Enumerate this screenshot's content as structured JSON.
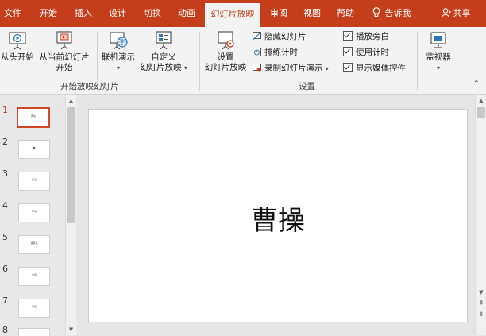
{
  "tabs": [
    {
      "label": "文件"
    },
    {
      "label": "开始"
    },
    {
      "label": "插入"
    },
    {
      "label": "设计"
    },
    {
      "label": "切换"
    },
    {
      "label": "动画"
    },
    {
      "label": "幻灯片放映"
    },
    {
      "label": "审阅"
    },
    {
      "label": "视图"
    },
    {
      "label": "帮助"
    }
  ],
  "tell_me": "告诉我",
  "share": "共享",
  "ribbon": {
    "from_beginning": "从头开始",
    "from_current_1": "从当前幻灯片",
    "from_current_2": "开始",
    "online_present": "联机演示",
    "custom_1": "自定义",
    "custom_2": "幻灯片放映",
    "group_start": "开始放映幻灯片",
    "setup_1": "设置",
    "setup_2": "幻灯片放映",
    "hide_slide": "隐藏幻灯片",
    "rehearse": "排练计时",
    "record": "录制幻灯片演示",
    "play_narration": "播放旁白",
    "use_timings": "使用计时",
    "show_media": "显示媒体控件",
    "group_setup": "设置",
    "monitor": "监视器"
  },
  "thumbnails": [
    {
      "num": "1",
      "text": "曹操"
    },
    {
      "num": "2",
      "text": "■"
    },
    {
      "num": "3",
      "text": "曹丕"
    },
    {
      "num": "4",
      "text": "司马"
    },
    {
      "num": "5",
      "text": "诸葛亮"
    },
    {
      "num": "6",
      "text": "刘备"
    },
    {
      "num": "7",
      "text": "孙权"
    },
    {
      "num": "8",
      "text": ""
    }
  ],
  "slide": {
    "title": "曹操"
  },
  "colors": {
    "accent": "#c43e1c",
    "selection": "#d24726"
  }
}
